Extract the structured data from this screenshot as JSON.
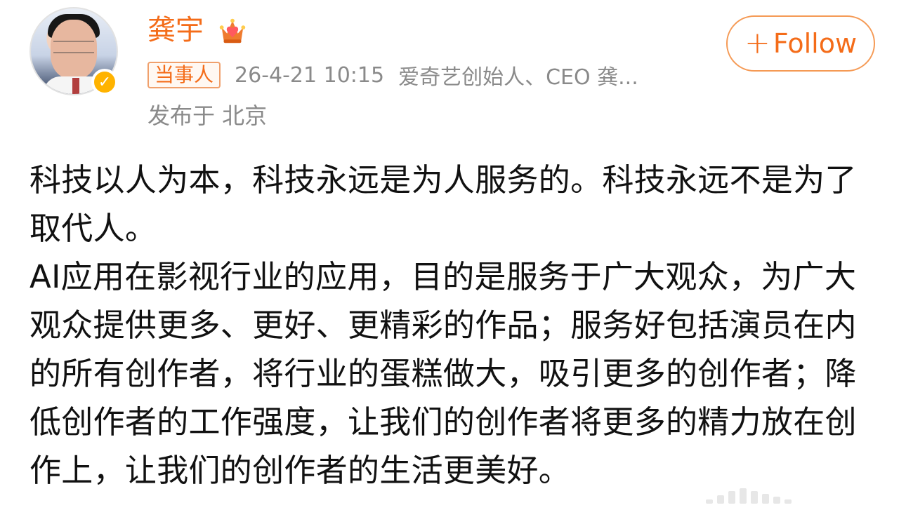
{
  "header": {
    "name": "龚宇",
    "crown_icon": "crown-icon",
    "verified_icon": "verified-icon",
    "role_tag": "当事人",
    "timestamp": "26-4-21 10:15",
    "source": "爱奇艺创始人、CEO 龚...",
    "location": "发布于 北京",
    "follow_label": "Follow"
  },
  "post": {
    "paragraph_1": "科技以人为本，科技永远是为人服务的。科技永远不是为了取代人。",
    "paragraph_2": "AI应用在影视行业的应用，目的是服务于广大观众，为广大观众提供更多、更好、更精彩的作品；服务好包括演员在内的所有创作者，将行业的蛋糕做大，吸引更多的创作者；降低创作者的工作强度，让我们的创作者将更多的精力放在创作上，让我们的创作者的生活更美好。"
  },
  "colors": {
    "accent": "#f46c19",
    "meta_text": "#8a8a8a",
    "verified_badge": "#ffb300"
  }
}
